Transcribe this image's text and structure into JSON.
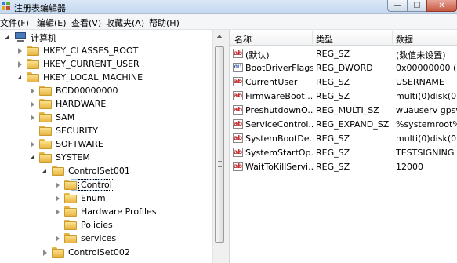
{
  "window": {
    "title": "注册表编辑器",
    "min_label": "—",
    "max_label": "☐",
    "close_label": "✕"
  },
  "menu": [
    "文件(F)",
    "编辑(E)",
    "查看(V)",
    "收藏夹(A)",
    "帮助(H)"
  ],
  "tree": {
    "root": "计算机",
    "nodes": [
      "HKEY_CLASSES_ROOT",
      "HKEY_CURRENT_USER",
      "HKEY_LOCAL_MACHINE",
      "BCD00000000",
      "HARDWARE",
      "SAM",
      "SECURITY",
      "SOFTWARE",
      "SYSTEM",
      "ControlSet001",
      "Control",
      "Enum",
      "Hardware Profiles",
      "Policies",
      "services",
      "ControlSet002"
    ]
  },
  "list": {
    "columns": [
      "名称",
      "类型",
      "数据"
    ],
    "rows": [
      {
        "icon": "string-value-icon",
        "name": "(默认)",
        "type": "REG_SZ",
        "data": "(数值未设置)"
      },
      {
        "icon": "binary-value-icon",
        "name": "BootDriverFlags",
        "type": "REG_DWORD",
        "data": "0x00000000 (0)"
      },
      {
        "icon": "string-value-icon",
        "name": "CurrentUser",
        "type": "REG_SZ",
        "data": "USERNAME"
      },
      {
        "icon": "string-value-icon",
        "name": "FirmwareBoot...",
        "type": "REG_SZ",
        "data": "multi(0)disk(0)r"
      },
      {
        "icon": "string-value-icon",
        "name": "PreshutdownO...",
        "type": "REG_MULTI_SZ",
        "data": "wuauserv gpsv"
      },
      {
        "icon": "string-value-icon",
        "name": "ServiceControl...",
        "type": "REG_EXPAND_SZ",
        "data": "%systemroot%"
      },
      {
        "icon": "string-value-icon",
        "name": "SystemBootDe...",
        "type": "REG_SZ",
        "data": "multi(0)disk(0)r"
      },
      {
        "icon": "string-value-icon",
        "name": "SystemStartOp...",
        "type": "REG_SZ",
        "data": " TESTSIGNING"
      },
      {
        "icon": "string-value-icon",
        "name": "WaitToKillServi...",
        "type": "REG_SZ",
        "data": "12000"
      }
    ]
  }
}
